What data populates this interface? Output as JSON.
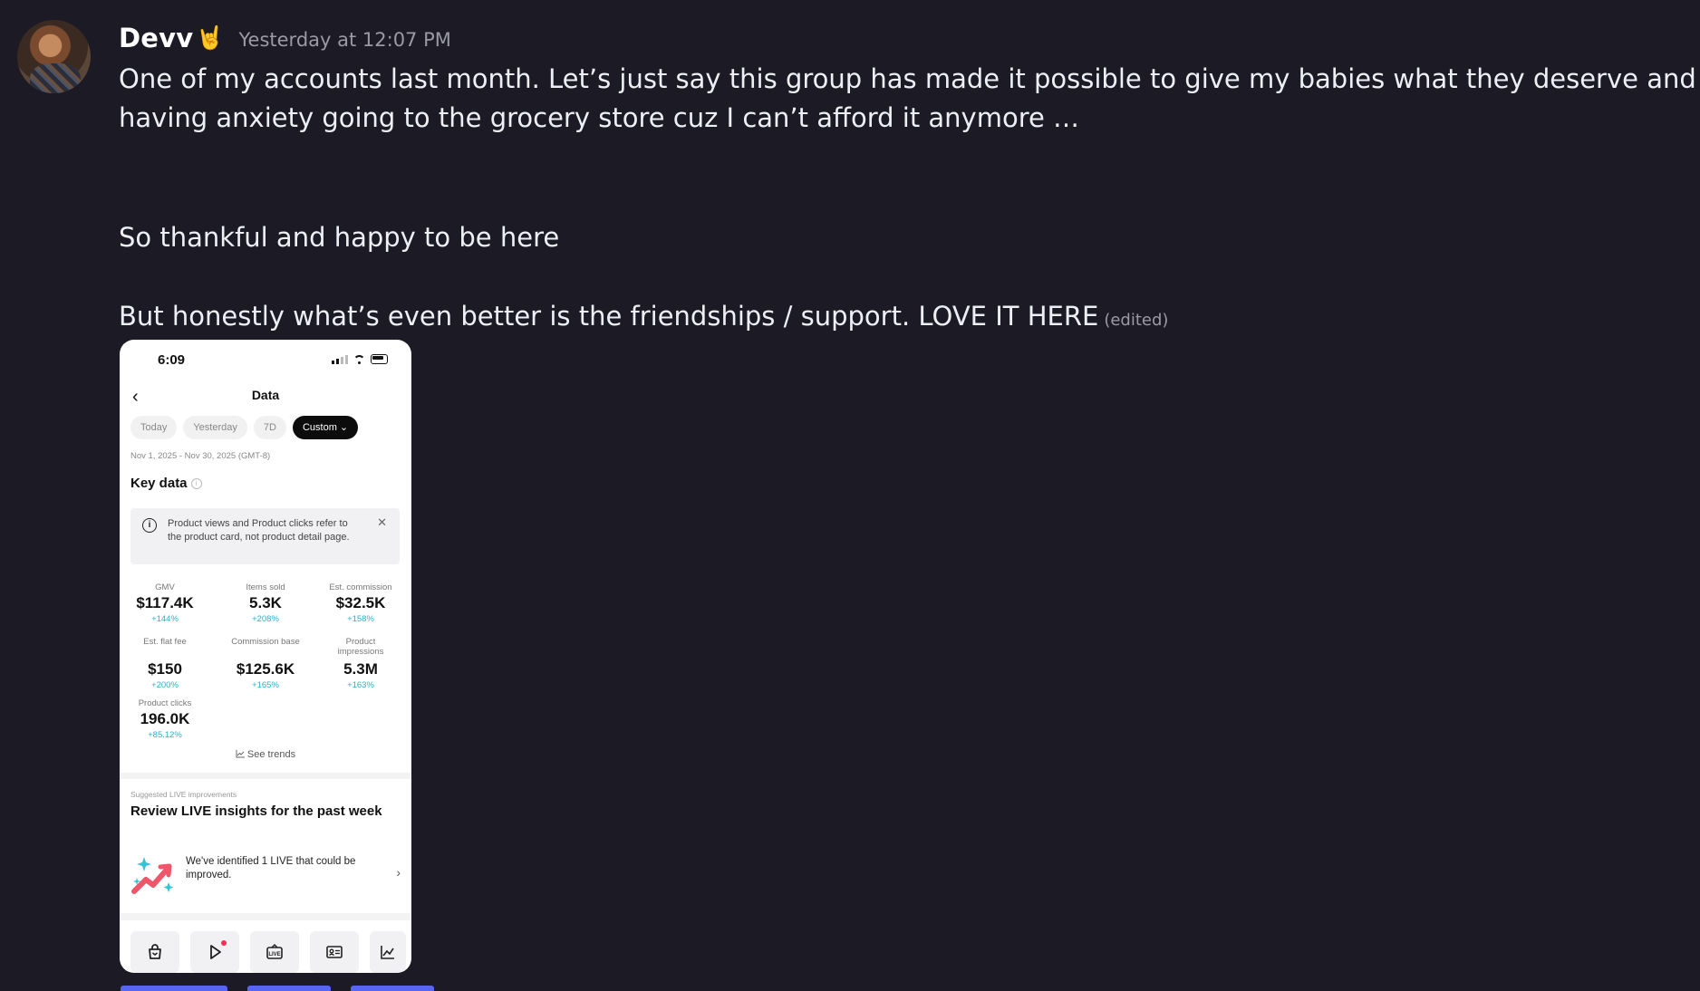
{
  "message": {
    "author": "Devv",
    "author_emoji": "🤘",
    "timestamp": "Yesterday at 12:07 PM",
    "line1": "One of my accounts last month. Let’s just say this group has made it possible to give my babies what they deserve and not",
    "line2": "having anxiety going to the grocery store cuz I can’t afford it anymore …",
    "line3": "So thankful and happy to be here",
    "line4": "But honestly what’s even better is the friendships / support.  LOVE IT HERE",
    "edited": "(edited)"
  },
  "phone": {
    "time": "6:09",
    "title": "Data",
    "back_icon": "chevron-left-icon",
    "chips": [
      "Today",
      "Yesterday",
      "7D",
      "Custom ⌄"
    ],
    "active_chip": "Custom",
    "date_range": "Nov 1, 2025 - Nov 30, 2025 (GMT-8)",
    "key_data_label": "Key data",
    "notice": "Product views and Product clicks refer to the product card, not product detail page.",
    "stats": [
      {
        "label": "GMV",
        "value": "$117.4K",
        "change": "+144%"
      },
      {
        "label": "Items sold",
        "value": "5.3K",
        "change": "+208%"
      },
      {
        "label": "Est. commission",
        "value": "$32.5K",
        "change": "+158%"
      },
      {
        "label": "Est. flat fee",
        "value": "$150",
        "change": "+200%"
      },
      {
        "label": "Commission base",
        "value": "$125.6K",
        "change": "+165%"
      },
      {
        "label": "Product impressions",
        "value": "5.3M",
        "change": "+163%"
      },
      {
        "label": "Product clicks",
        "value": "196.0K",
        "change": "+85.12%"
      }
    ],
    "see_trends": "See trends",
    "suggested_label": "Suggested LIVE improvements",
    "review_title": "Review LIVE insights for the past week",
    "improve_text": "We've identified 1 LIVE that could be improved.",
    "tab_icons": [
      "shopping-bag-icon",
      "play-icon",
      "live-icon",
      "id-card-icon",
      "chart-icon"
    ],
    "colors": {
      "accent_change": "#2ab3c6",
      "notification_dot": "#fe2c55"
    }
  }
}
